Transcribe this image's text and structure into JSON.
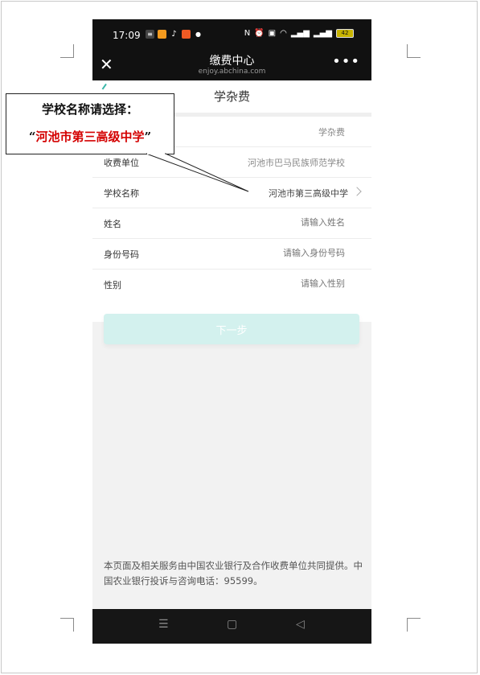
{
  "status_bar": {
    "time": "17:09",
    "battery": "42"
  },
  "nav": {
    "title": "缴费中心",
    "domain": "enjoy.abchina.com"
  },
  "page": {
    "title": "学杂费"
  },
  "form": {
    "rows": [
      {
        "label": "",
        "value": "学杂费"
      },
      {
        "label": "收费单位",
        "value": "河池市巴马民族师范学校"
      },
      {
        "label": "学校名称",
        "value": "河池市第三高级中学"
      },
      {
        "label": "姓名",
        "placeholder": "请输入姓名"
      },
      {
        "label": "身份号码",
        "placeholder": "请输入身份号码"
      },
      {
        "label": "性别",
        "placeholder": "请输入性别"
      }
    ]
  },
  "next_button": "下一步",
  "footer": "本页面及相关服务由中国农业银行及合作收费单位共同提供。中国农业银行投诉与咨询电话：95599。",
  "callout": {
    "line1": "学校名称请选择：",
    "quote_open": "“",
    "school": "河池市第三高级中学",
    "quote_close": "”"
  },
  "colors": {
    "accent": "#3bb7a9",
    "button_bg": "#d3f1ee",
    "callout_highlight": "#d40000",
    "header_bg": "#111111"
  }
}
